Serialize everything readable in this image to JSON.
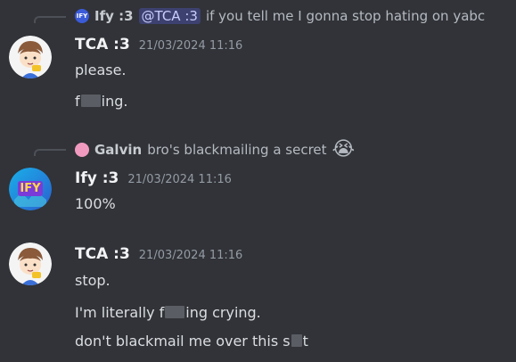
{
  "messages": [
    {
      "reply": {
        "author": "Ify :3",
        "avatar_text": "IFY",
        "mention": "@TCA :3",
        "text": "if you tell me I gonna stop hating on yabc"
      },
      "author": "TCA :3",
      "timestamp": "21/03/2024 11:16",
      "lines": [
        {
          "before": "please.",
          "after": ""
        },
        {
          "before": "f",
          "after": "ing."
        }
      ]
    },
    {
      "reply": {
        "author": "Galvin",
        "text": "bro's blackmailing a secret",
        "emoji": "😭"
      },
      "author": "Ify :3",
      "avatar_text": "IFY",
      "timestamp": "21/03/2024 11:16",
      "lines": [
        {
          "before": "100%",
          "after": ""
        }
      ]
    },
    {
      "author": "TCA :3",
      "timestamp": "21/03/2024 11:16",
      "lines": [
        {
          "before": "stop.",
          "after": ""
        },
        {
          "before": "I'm literally f",
          "after": "ing crying."
        },
        {
          "before": "don't blackmail me over this s",
          "after": "t"
        }
      ]
    }
  ],
  "colors": {
    "background": "#313338",
    "username": "#f2f3f5",
    "timestamp": "#949ba4",
    "mention_bg": "#3c4270",
    "censor": "#5a5d64"
  }
}
